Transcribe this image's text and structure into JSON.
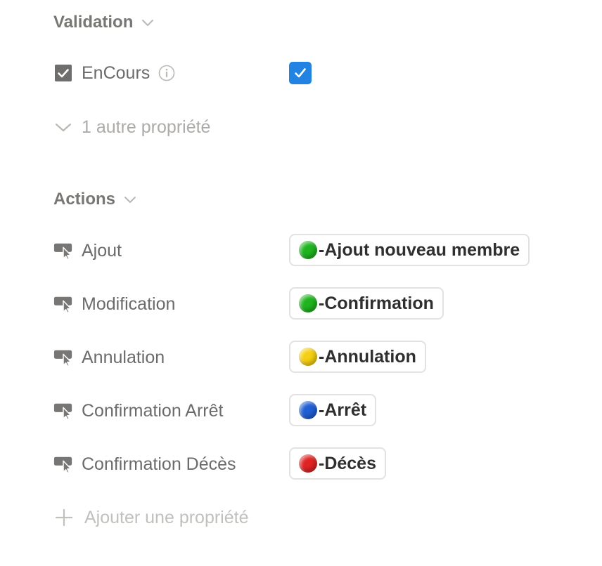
{
  "validation": {
    "title": "Validation",
    "encours": {
      "label": "EnCours",
      "checked": true
    },
    "more_label": "1 autre propriété"
  },
  "actions": {
    "title": "Actions",
    "items": [
      {
        "label": "Ajout",
        "button_label": "-Ajout nouveau membre",
        "dot_color": "#1fb41f"
      },
      {
        "label": "Modification",
        "button_label": "-Confirmation",
        "dot_color": "#1fb41f"
      },
      {
        "label": "Annulation",
        "button_label": "-Annulation",
        "dot_color": "#f5cf12"
      },
      {
        "label": "Confirmation Arrêt",
        "button_label": "-Arrêt",
        "dot_color": "#1f5fd4"
      },
      {
        "label": "Confirmation Décès",
        "button_label": "-Décès",
        "dot_color": "#e02424"
      }
    ]
  },
  "add_property_label": "Ajouter une propriété",
  "colors": {
    "accent": "#2383e2",
    "muted_text": "#787774",
    "faint_text": "#acaba9",
    "button_border": "#e3e2e0"
  }
}
